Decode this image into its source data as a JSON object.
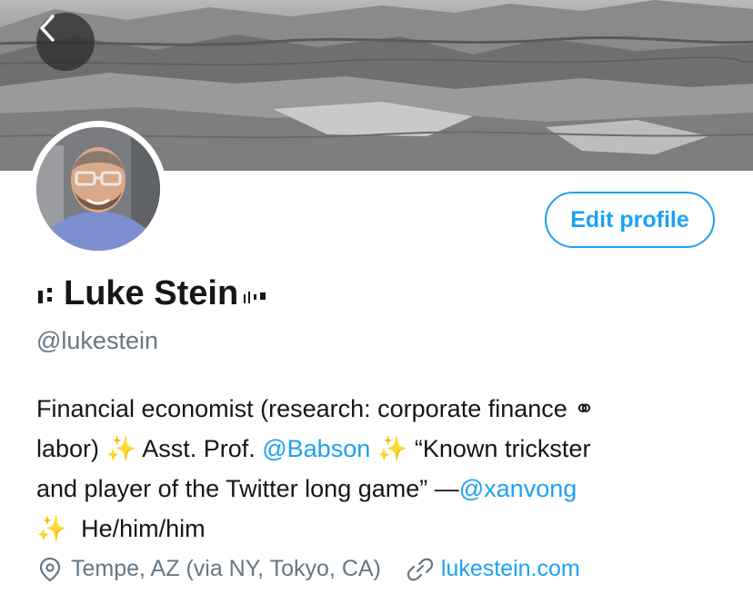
{
  "header": {
    "back_icon": "chevron-left-icon"
  },
  "profile": {
    "display_name": "Luke Stein",
    "handle": "@lukestein",
    "edit_button_label": "Edit profile"
  },
  "bio": {
    "line1": "Financial economist (research: corporate finance ⚭",
    "line2_a": "labor)",
    "line2_b": "Asst. Prof.",
    "mention_babson": "@Babson",
    "line2_c": "“Known trickster",
    "line3_a": "and player of the Twitter long game” —",
    "mention_xanvong": "@xanvong",
    "line4": "He/him/him",
    "sparkle": "✨"
  },
  "meta": {
    "location_icon": "location-pin-icon",
    "location": "Tempe, AZ (via NY, Tokyo, CA)",
    "link_icon": "link-icon",
    "website": "lukestein.com"
  },
  "colors": {
    "accent": "#1da1f2",
    "secondary_text": "#657786",
    "primary_text": "#14171a"
  }
}
